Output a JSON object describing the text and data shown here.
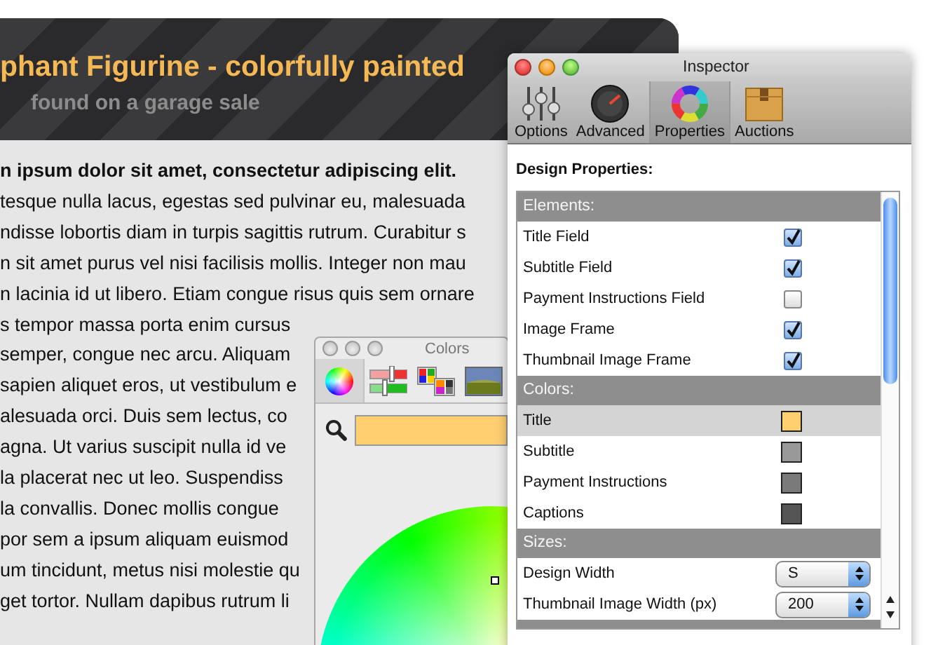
{
  "background_page": {
    "title": "phant Figurine - colorfully painted",
    "subtitle": "found on a garage sale",
    "lines": [
      {
        "text": "n ipsum dolor sit amet, consectetur adipiscing elit.",
        "bold": true
      },
      {
        "text": "tesque nulla lacus, egestas sed pulvinar eu, malesuada",
        "bold": false
      },
      {
        "text": "ndisse lobortis diam in turpis sagittis rutrum. Curabitur s",
        "bold": false
      },
      {
        "text": "n sit amet purus vel nisi facilisis mollis. Integer non mau",
        "bold": false
      },
      {
        "text": "n lacinia id ut libero. Etiam congue risus quis sem ornare",
        "bold": false
      },
      {
        "text": "s tempor massa porta enim cursus",
        "bold": false
      },
      {
        "text": "semper, congue nec arcu. Aliquam",
        "bold": false
      },
      {
        "text": "sapien aliquet eros, ut vestibulum e",
        "bold": false
      },
      {
        "text": "alesuada orci. Duis sem lectus, co",
        "bold": false
      },
      {
        "text": "agna. Ut varius suscipit nulla id ve",
        "bold": false
      },
      {
        "text": "la placerat nec ut leo. Suspendiss",
        "bold": false
      },
      {
        "text": "la convallis. Donec mollis congue",
        "bold": false
      },
      {
        "text": "por sem a ipsum aliquam euismod",
        "bold": false
      },
      {
        "text": "um tincidunt, metus nisi molestie qu",
        "bold": false
      },
      {
        "text": "get tortor. Nullam dapibus rutrum li",
        "bold": false
      }
    ]
  },
  "colors_panel": {
    "title": "Colors",
    "tools": [
      {
        "kind": "wheel",
        "selected": true
      },
      {
        "kind": "sliders",
        "selected": false
      },
      {
        "kind": "palettes",
        "selected": false
      },
      {
        "kind": "image",
        "selected": false
      }
    ]
  },
  "inspector": {
    "title": "Inspector",
    "tabs": [
      {
        "label": "Options",
        "kind": "sliders",
        "selected": false
      },
      {
        "label": "Advanced",
        "kind": "gauge",
        "selected": false
      },
      {
        "label": "Properties",
        "kind": "ring",
        "selected": true
      },
      {
        "label": "Auctions",
        "kind": "box",
        "selected": false
      }
    ],
    "heading": "Design Properties:",
    "sections": [
      {
        "title": "Elements:",
        "rows": [
          {
            "kind": "checkbox",
            "label": "Title Field",
            "checked": true
          },
          {
            "kind": "checkbox",
            "label": "Subtitle Field",
            "checked": true
          },
          {
            "kind": "checkbox",
            "label": "Payment Instructions Field",
            "checked": false
          },
          {
            "kind": "checkbox",
            "label": "Image Frame",
            "checked": true
          },
          {
            "kind": "checkbox",
            "label": "Thumbnail Image Frame",
            "checked": true
          }
        ]
      },
      {
        "title": "Colors:",
        "rows": [
          {
            "kind": "color",
            "label": "Title",
            "color": "#ffcf70",
            "selected": true
          },
          {
            "kind": "color",
            "label": "Subtitle",
            "color": "#999999",
            "selected": false
          },
          {
            "kind": "color",
            "label": "Payment Instructions",
            "color": "#7a7a7a",
            "selected": false
          },
          {
            "kind": "color",
            "label": "Captions",
            "color": "#555555",
            "selected": false
          }
        ]
      },
      {
        "title": "Sizes:",
        "rows": [
          {
            "kind": "select",
            "label": "Design Width",
            "value": "S"
          },
          {
            "kind": "select",
            "label": "Thumbnail Image Width (px)",
            "value": "200"
          }
        ]
      }
    ]
  }
}
